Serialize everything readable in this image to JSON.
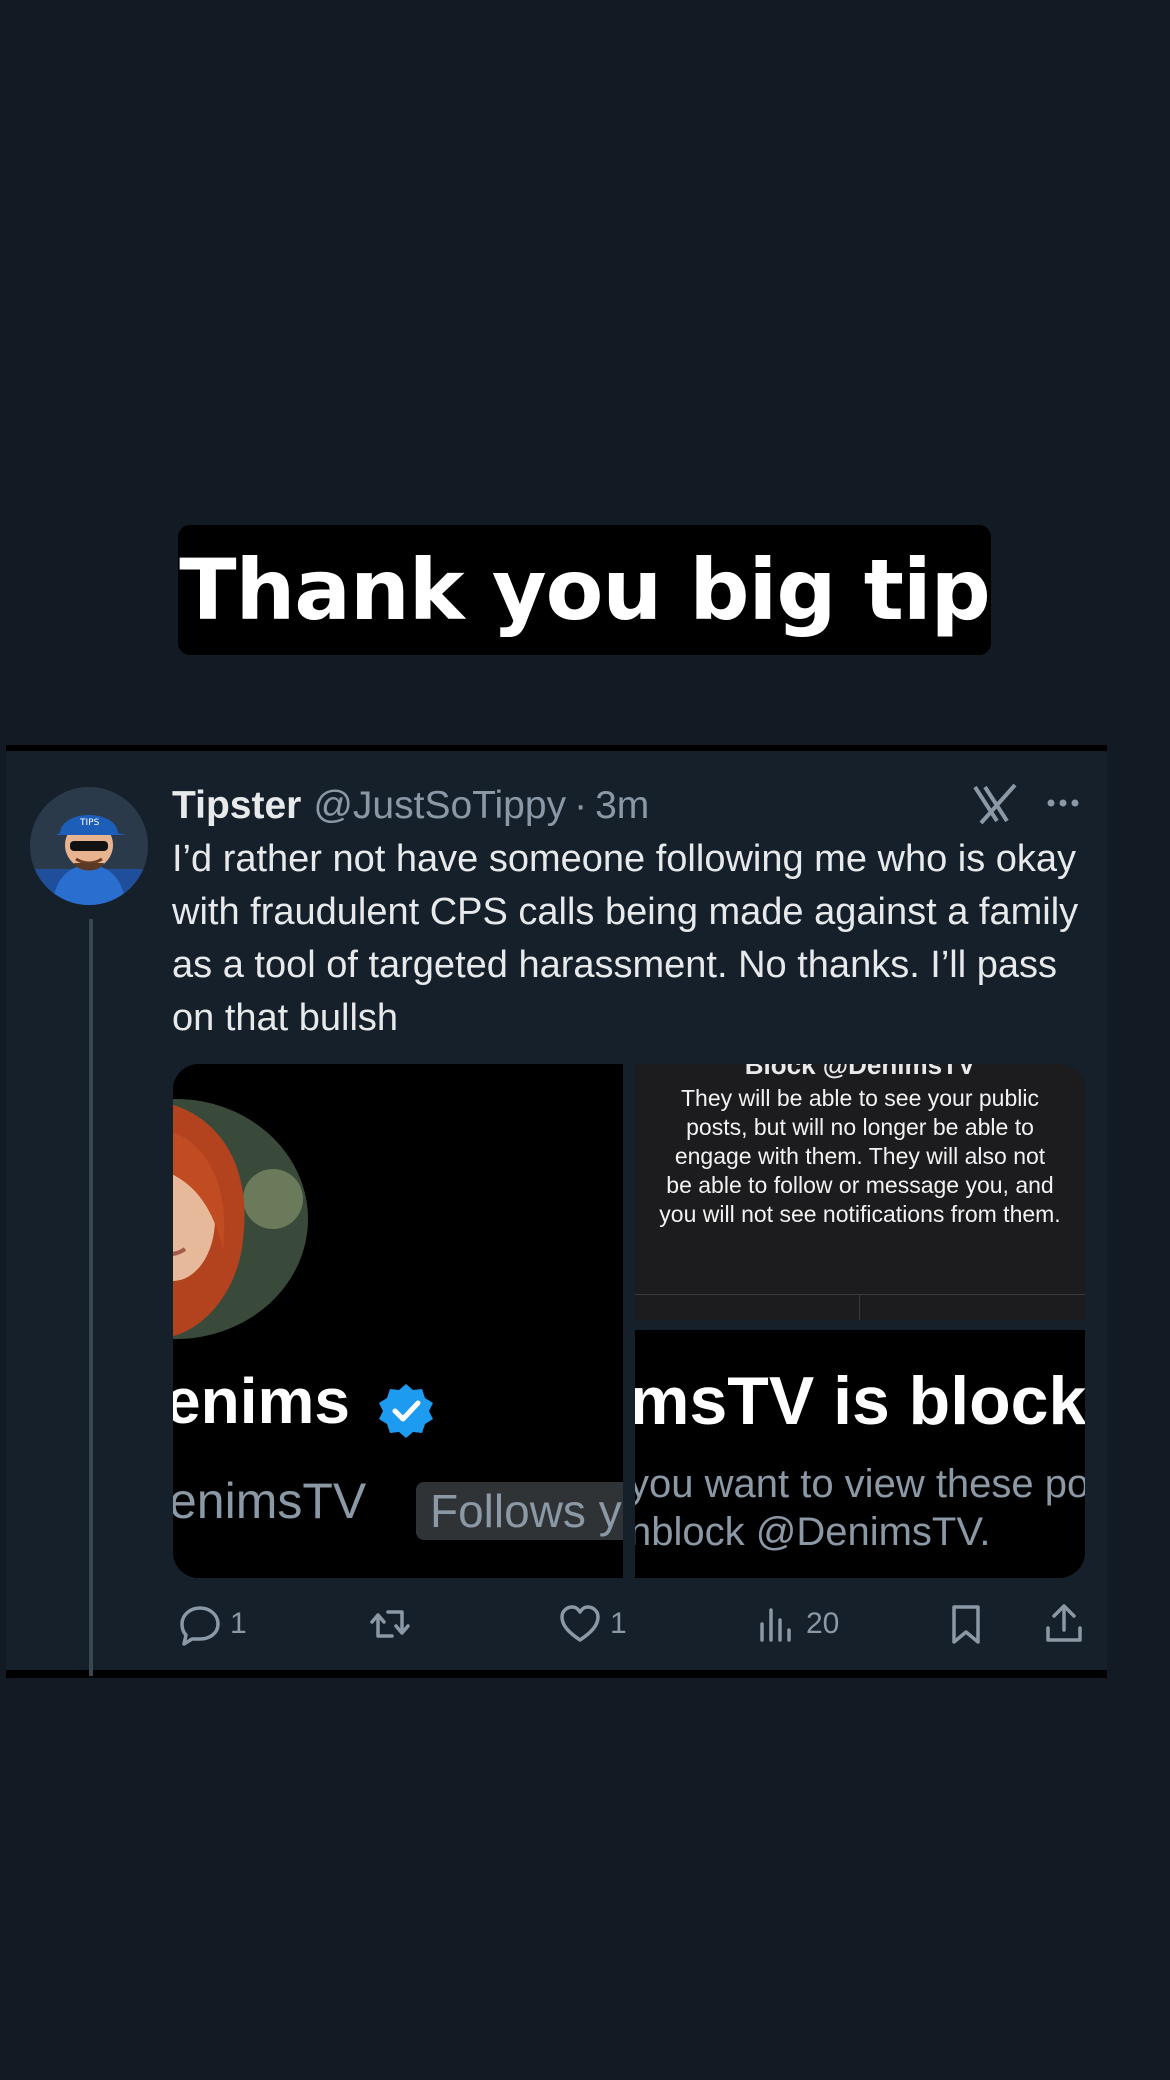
{
  "caption": {
    "text": "Thank you big tip"
  },
  "tweet": {
    "display_name": "Tipster",
    "handle": "@JustSoTippy",
    "separator": "·",
    "time": "3m",
    "text": "I’d rather not have someone following me who is okay with fraudulent CPS calls being made against a family as a tool of targeted harassment. No thanks. I’ll pass on that bullsh",
    "avatar_icon": "cartoon-avatar",
    "media": {
      "profile_name": "enims",
      "profile_handle": "enimsTV",
      "follows_label": "Follows y",
      "dialog_title": "Block @DenimsTV",
      "dialog_body": "They will be able to see your public posts, but will no longer be able to engage with them. They will also not be able to follow or message you, and you will not see notifications from them.",
      "blocked_title": "msTV is block",
      "blocked_line1": "you want to view these po",
      "blocked_line2": "nblock @DenimsTV."
    },
    "actions": {
      "reply_count": "1",
      "like_count": "1",
      "views_count": "20"
    }
  },
  "colors": {
    "background": "#121a24",
    "card": "#15202b",
    "text": "#e7e9ea",
    "muted": "#8b98a5",
    "verified": "#1d9bf0"
  }
}
